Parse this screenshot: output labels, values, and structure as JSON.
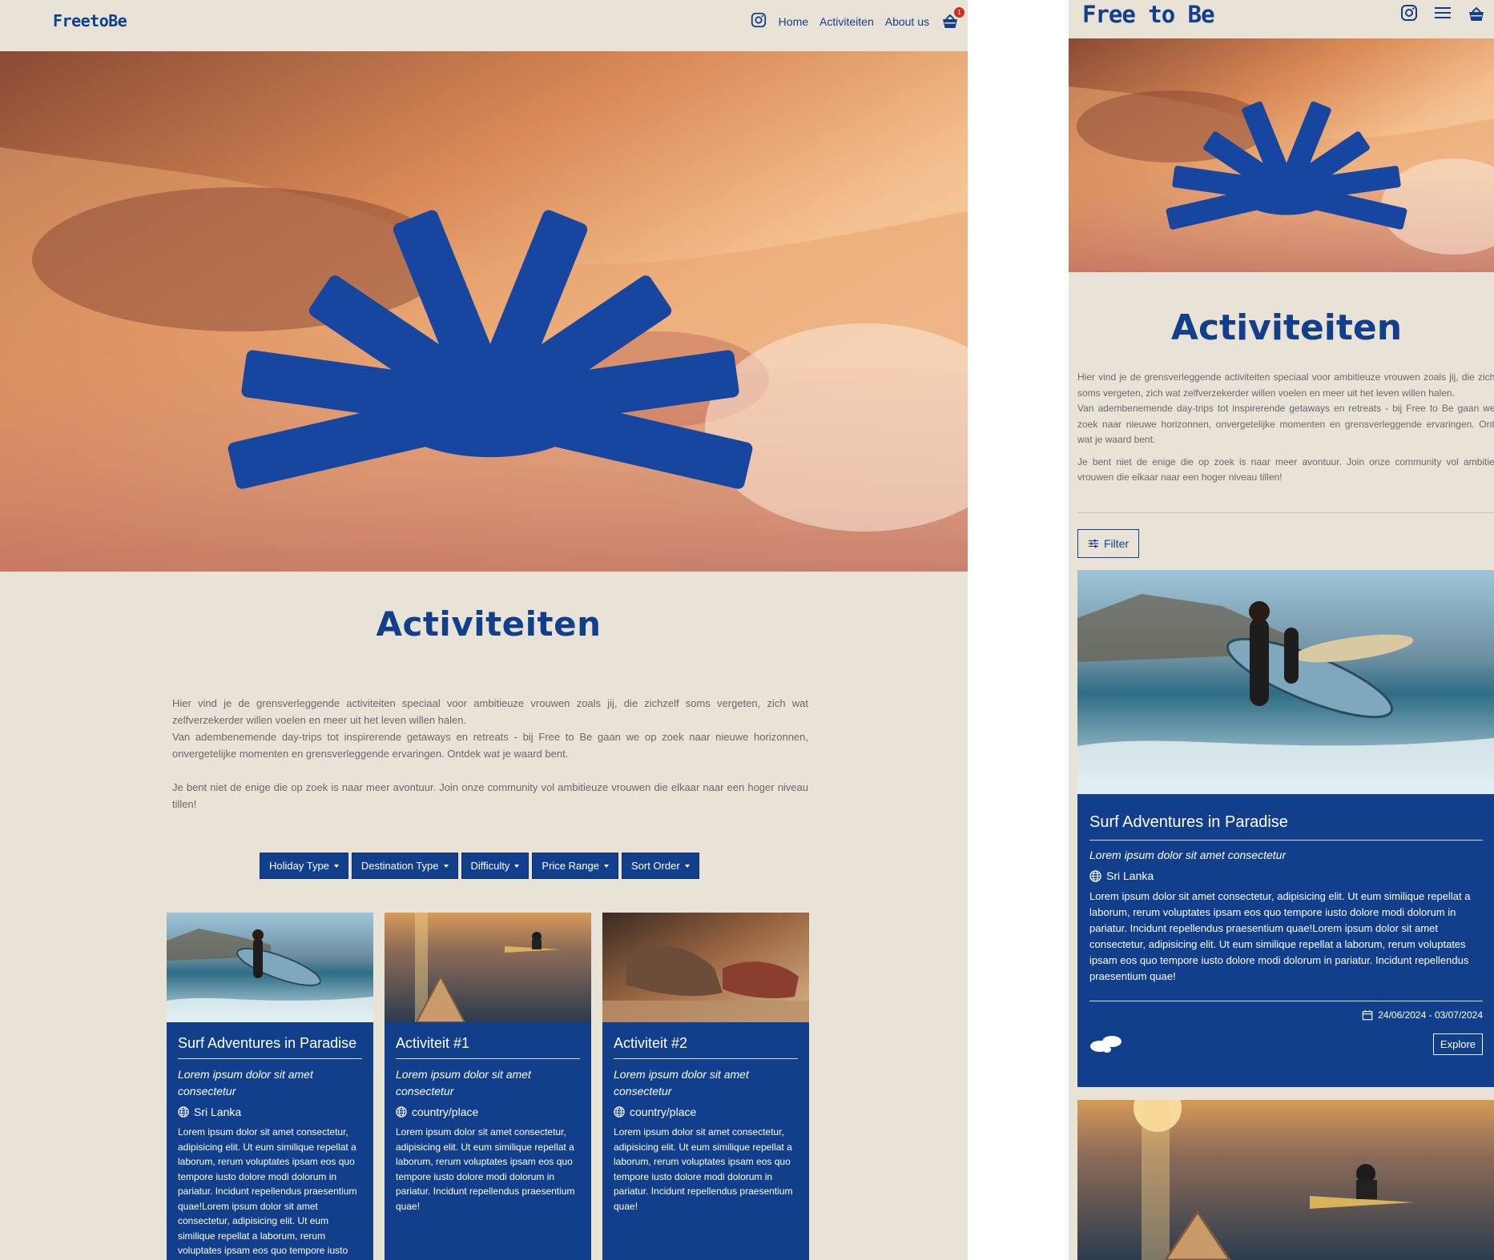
{
  "brand": {
    "logo": "FreetoBe",
    "primary": "#123f8c",
    "background": "#e9e2d6"
  },
  "nav": {
    "home": "Home",
    "activities": "Activiteiten",
    "about": "About us",
    "cart_count": "1"
  },
  "page": {
    "title": "Activiteiten",
    "intro_p1": "Hier vind je de grensverleggende activiteiten speciaal voor ambitieuze vrouwen zoals jij, die zichzelf soms vergeten, zich wat zelfverzekerder willen voelen en meer uit het leven willen halen.",
    "intro_p2": "Van adembenemende day-trips tot inspirerende getaways en retreats - bij Free to Be gaan we op zoek naar nieuwe horizonnen, onvergetelijke momenten en grensverleggende ervaringen. Ontdek wat je waard bent.",
    "intro_p3": "Je bent niet de enige die op zoek is naar meer avontuur. Join onze community vol ambitieuze vrouwen die elkaar naar een hoger niveau tillen!"
  },
  "filters": [
    "Holiday Type",
    "Destination Type",
    "Difficulty",
    "Price Range",
    "Sort Order"
  ],
  "cards": [
    {
      "title": "Surf Adventures in Paradise",
      "subtitle": "Lorem ipsum dolor sit amet consectetur",
      "location": "Sri Lanka",
      "description": "Lorem ipsum dolor sit amet consectetur, adipisicing elit. Ut eum similique repellat a laborum, rerum voluptates ipsam eos quo tempore iusto dolore modi dolorum in pariatur. Incidunt repellendus praesentium quae!Lorem ipsum dolor sit amet consectetur, adipisicing elit. Ut eum similique repellat a laborum, rerum voluptates ipsam eos quo tempore iusto"
    },
    {
      "title": "Activiteit #1",
      "subtitle": "Lorem ipsum dolor sit amet consectetur",
      "location": "country/place",
      "description": "Lorem ipsum dolor sit amet consectetur, adipisicing elit. Ut eum similique repellat a laborum, rerum voluptates ipsam eos quo tempore iusto dolore modi dolorum in pariatur. Incidunt repellendus praesentium quae!"
    },
    {
      "title": "Activiteit #2",
      "subtitle": "Lorem ipsum dolor sit amet consectetur",
      "location": "country/place",
      "description": "Lorem ipsum dolor sit amet consectetur, adipisicing elit. Ut eum similique repellat a laborum, rerum voluptates ipsam eos quo tempore iusto dolore modi dolorum in pariatur. Incidunt repellendus praesentium quae!"
    }
  ],
  "mobile": {
    "logo": "Free to Be",
    "title": "Activiteiten",
    "intro_p1": "Hier vind je de grensverleggende activiteiten speciaal voor ambitieuze vrouwen zoals jij, die zichzelf soms vergeten, zich wat zelfverzekerder willen voelen en meer uit het leven willen halen.",
    "intro_p2": "Van adembenemende day-trips tot inspirerende getaways en retreats - bij Free to Be gaan we op zoek naar nieuwe horizonnen, onvergetelijke momenten en grensverleggende ervaringen. Ontdek wat je waard bent.",
    "intro_p3": "Je bent niet de enige die op zoek is naar meer avontuur. Join onze community vol ambitieuze vrouwen die elkaar naar een hoger niveau tillen!",
    "filter_label": "Filter",
    "card": {
      "title": "Surf Adventures in Paradise",
      "subtitle": "Lorem ipsum dolor sit amet consectetur",
      "location": "Sri Lanka",
      "description": "Lorem ipsum dolor sit amet consectetur, adipisicing elit. Ut eum similique repellat a laborum, rerum voluptates ipsam eos quo tempore iusto dolore modi dolorum in pariatur. Incidunt repellendus praesentium quae!Lorem ipsum dolor sit amet consectetur, adipisicing elit. Ut eum similique repellat a laborum, rerum voluptates ipsam eos quo tempore iusto dolore modi dolorum in pariatur. Incidunt repellendus praesentium quae!",
      "dates": "24/06/2024 - 03/07/2024",
      "explore": "Explore"
    }
  },
  "icons": {
    "instagram": "instagram-icon",
    "cart": "basket-icon",
    "menu": "hamburger-menu-icon",
    "globe": "globe-icon",
    "calendar": "calendar-icon",
    "difficulty": "shoe-prints-icon",
    "filter": "sliders-icon"
  }
}
